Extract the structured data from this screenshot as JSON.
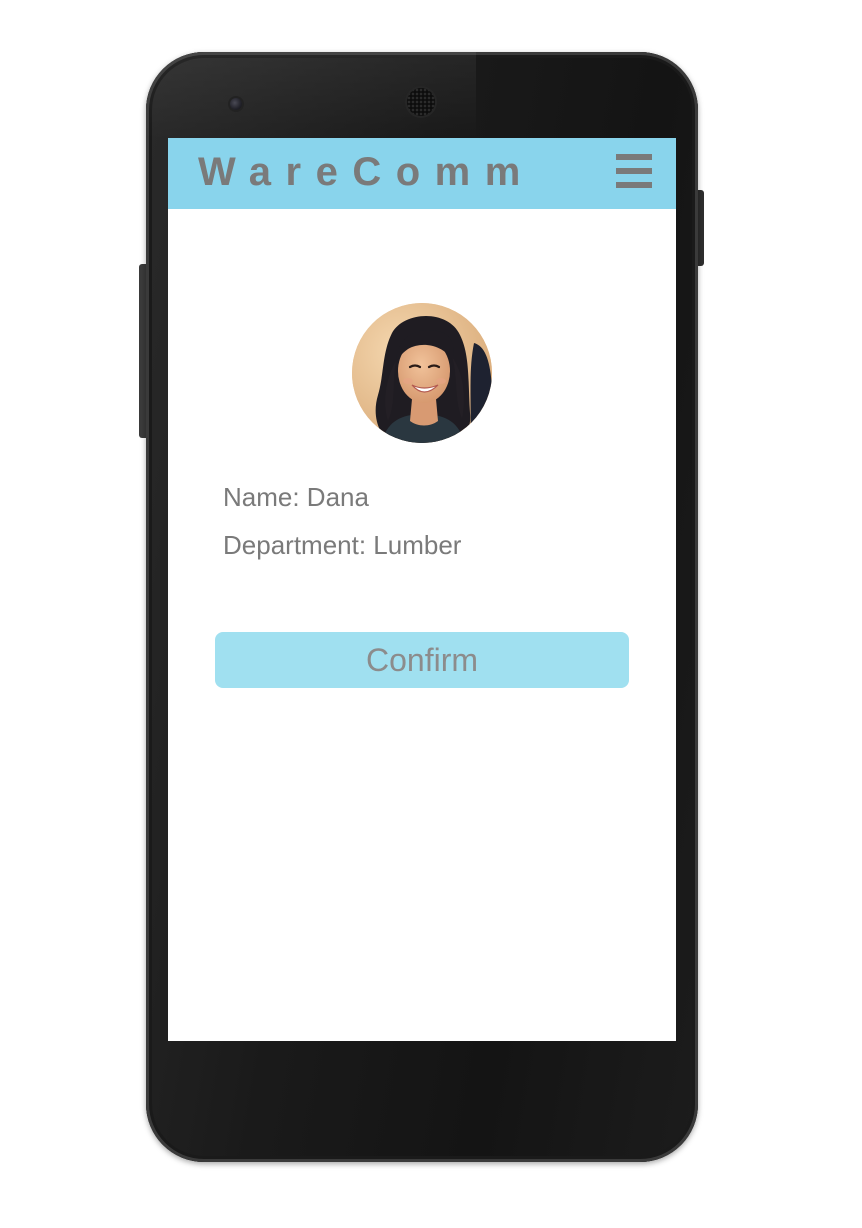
{
  "app": {
    "title": "WareComm",
    "accent_color": "#89d4ec",
    "menu_icon": "hamburger-menu-icon"
  },
  "profile": {
    "avatar_icon": "user-photo",
    "name_line": "Name: Dana",
    "department_line": "Department: Lumber"
  },
  "actions": {
    "confirm_label": "Confirm",
    "confirm_color": "#a0e0f0"
  },
  "colors": {
    "text": "#7a7a7a",
    "device_body": "#141414"
  }
}
